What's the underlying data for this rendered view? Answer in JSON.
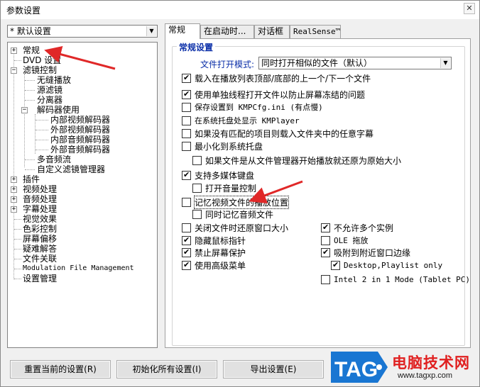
{
  "window": {
    "title": "参数设置",
    "close_glyph": "✕"
  },
  "preset": {
    "value": "* 默认设置"
  },
  "tree": {
    "items": [
      {
        "label": "常规",
        "expander": "+"
      },
      {
        "label": "DVD 设置",
        "expander": ""
      },
      {
        "label": "滤镜控制",
        "expander": "−"
      },
      {
        "label": "无缝播放"
      },
      {
        "label": "源滤镜"
      },
      {
        "label": "分离器"
      },
      {
        "label": "解码器使用",
        "expander": "−"
      },
      {
        "label": "内部视频解码器"
      },
      {
        "label": "外部视频解码器"
      },
      {
        "label": "内部音频解码器"
      },
      {
        "label": "外部音频解码器"
      },
      {
        "label": "多音频流"
      },
      {
        "label": "自定义滤镜管理器"
      },
      {
        "label": "插件",
        "expander": "+"
      },
      {
        "label": "视频处理",
        "expander": "+"
      },
      {
        "label": "音频处理",
        "expander": "+"
      },
      {
        "label": "字幕处理",
        "expander": "+"
      },
      {
        "label": "视觉效果"
      },
      {
        "label": "色彩控制"
      },
      {
        "label": "屏幕偏移"
      },
      {
        "label": "疑难解答"
      },
      {
        "label": "文件关联"
      },
      {
        "label": "Modulation File Management"
      },
      {
        "label": "设置管理"
      }
    ]
  },
  "tabs": [
    {
      "label": "常规",
      "active": true
    },
    {
      "label": "在启动时..."
    },
    {
      "label": "对话框"
    },
    {
      "label": "RealSense™"
    }
  ],
  "general": {
    "group_title": "常规设置",
    "open_mode_label": "文件打开模式:",
    "open_mode_value": "同时打开相似的文件（默认）",
    "options": [
      {
        "label": "载入在播放列表顶部/底部的上一个/下一个文件",
        "checked": true
      },
      {
        "label": "使用单独线程打开文件以防止屏幕冻结的问题",
        "checked": true
      },
      {
        "label": "保存设置到 KMPCfg.ini (有点慢)",
        "checked": false
      },
      {
        "label": "在系统托盘处显示 KMPlayer",
        "checked": false
      },
      {
        "label": "如果没有匹配的项目则载入文件夹中的任意字幕",
        "checked": false
      },
      {
        "label": "最小化到系统托盘",
        "checked": false
      },
      {
        "label": "如果文件是从文件管理器开始播放就还原为原始大小",
        "checked": false
      },
      {
        "label": "支持多媒体键盘",
        "checked": true
      },
      {
        "label": "打开音量控制",
        "checked": false
      },
      {
        "label": "记忆视频文件的播放位置",
        "checked": false
      },
      {
        "label": "同时记忆音频文件",
        "checked": false
      }
    ],
    "left_options": [
      {
        "label": "关闭文件时还原窗口大小",
        "checked": false
      },
      {
        "label": "隐藏鼠标指针",
        "checked": true
      },
      {
        "label": "禁止屏幕保护",
        "checked": true
      },
      {
        "label": "使用高级菜单",
        "checked": true
      }
    ],
    "right_options": [
      {
        "label": "不允许多个实例",
        "checked": true
      },
      {
        "label": "OLE 拖放",
        "checked": false
      },
      {
        "label": "吸附到附近窗口边缘",
        "checked": true
      },
      {
        "label": "Desktop,Playlist only",
        "checked": true
      },
      {
        "label": "Intel 2 in 1 Mode (Tablet PC)",
        "checked": false
      }
    ]
  },
  "buttons": {
    "reset_current": "重置当前的设置(R)",
    "init_all": "初始化所有设置(I)",
    "export": "导出设置(E)"
  },
  "watermark": {
    "logo_text": "TAG",
    "site_name": "电脑技术网",
    "url": "www.tagxp.com"
  },
  "colors": {
    "arrow": "#e02828",
    "label_blue": "#0a2ea8",
    "watermark_blue": "#1976d2",
    "watermark_red": "#e02020"
  }
}
